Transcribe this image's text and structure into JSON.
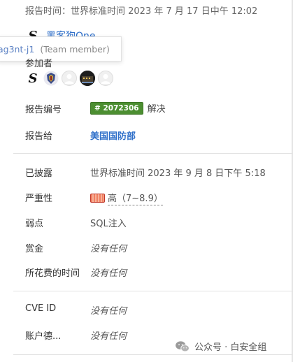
{
  "header": {
    "report_time": "报告时间：世界标准时间 2023 年 7 月 17 日中午 12:02"
  },
  "reporter": {
    "name": "黑客狗One",
    "tooltip_handle": "ag3nt-j1",
    "tooltip_role": "(Team member)"
  },
  "participants": {
    "label": "参加者",
    "count": 5
  },
  "details": {
    "report_id_label": "报告编号",
    "report_id_tag": "# 2072306",
    "report_id_status": "解决",
    "reported_to_label": "报告给",
    "reported_to_value": "美国国防部",
    "disclosed_label": "已披露",
    "disclosed_value": "世界标准时间 2023 年 9 月 8 日下午 5:18",
    "severity_label": "严重性",
    "severity_value": "高（7~8.9）",
    "weakness_label": "弱点",
    "weakness_value": "SQL注入",
    "bounty_label": "赏金",
    "bounty_value": "没有任何",
    "time_spent_label": "所花费的时间",
    "time_spent_value": "没有任何",
    "cve_label": "CVE ID",
    "cve_value": "没有任何",
    "account_label": "账户德...",
    "account_value": "没有任何"
  },
  "watermark": {
    "text": "公众号 · 白安全组"
  },
  "colors": {
    "link": "#2f6fc9",
    "tag_green": "#4c8e31",
    "severity_high": "#f08060"
  }
}
